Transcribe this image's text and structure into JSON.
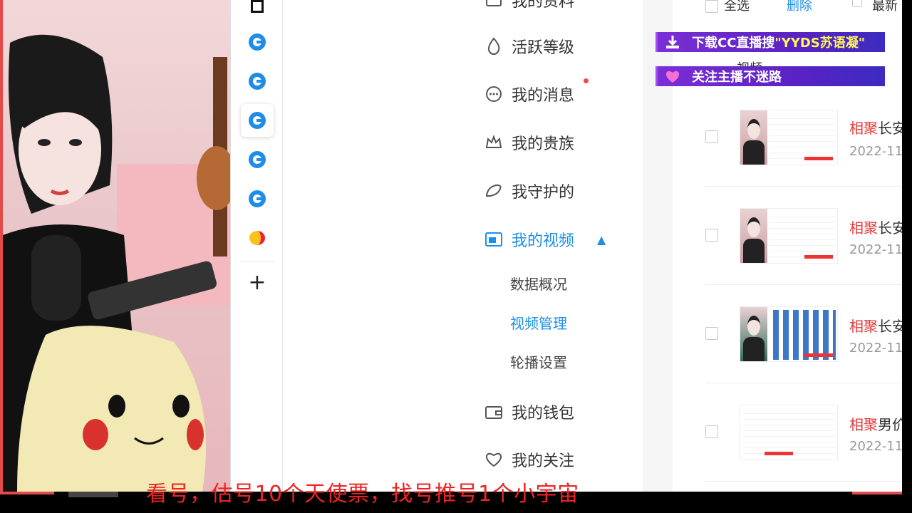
{
  "sidebar_icons": [
    "cc-icon",
    "cc-icon",
    "cc-icon",
    "cc-icon",
    "cc-icon",
    "duck-icon"
  ],
  "menu": {
    "items": [
      {
        "label": "我的资料",
        "icon": "profile-icon"
      },
      {
        "label": "活跃等级",
        "icon": "flame-icon"
      },
      {
        "label": "我的消息",
        "icon": "message-icon"
      },
      {
        "label": "我的贵族",
        "icon": "crown-icon"
      },
      {
        "label": "我守护的",
        "icon": "wing-icon"
      },
      {
        "label": "我的视频",
        "icon": "video-icon"
      },
      {
        "label": "我的钱包",
        "icon": "wallet-icon"
      },
      {
        "label": "我的关注",
        "icon": "heart-icon"
      }
    ],
    "video_sub": [
      "数据概况",
      "视频管理",
      "轮播设置"
    ]
  },
  "header": {
    "select_all": "全选",
    "delete": "删除",
    "sort": "最新",
    "video_tab": "视频"
  },
  "banners": {
    "download_prefix": "下载CC直播搜",
    "download_keyword": "\"YYDS苏语凝\"",
    "follow": "关注主播不迷路"
  },
  "videos": [
    {
      "title_hl": "相聚",
      "title_rest": "长安",
      "date": "2022-11"
    },
    {
      "title_hl": "相聚",
      "title_rest": "长安",
      "date": "2022-11"
    },
    {
      "title_hl": "相聚",
      "title_rest": "长安",
      "date": "2022-11"
    },
    {
      "title_hl": "相聚",
      "title_rest": "男价",
      "date": "2022-11"
    }
  ],
  "subtitle": "看号，估号10个天使票，找号推号1个小宇宙",
  "colors": {
    "accent": "#1a8fe8",
    "highlight": "#e23b3b",
    "banner": "#5a22c4",
    "subtitle": "#f02222"
  }
}
